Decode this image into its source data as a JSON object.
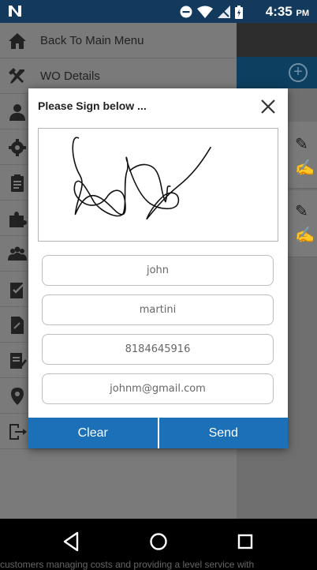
{
  "status_bar": {
    "time": "4:35",
    "ampm": "PM"
  },
  "drawer": {
    "items": [
      {
        "label": "Back To Main Menu",
        "icon": "home-icon"
      },
      {
        "label": "WO Details",
        "icon": "tools-icon"
      },
      {
        "label": "",
        "icon": "person-icon"
      },
      {
        "label": "",
        "icon": "gear-icon"
      },
      {
        "label": "",
        "icon": "clipboard-icon"
      },
      {
        "label": "",
        "icon": "puzzle-icon"
      },
      {
        "label": "",
        "icon": "group-icon"
      },
      {
        "label": "",
        "icon": "checklist-icon"
      },
      {
        "label": "",
        "icon": "document-icon"
      },
      {
        "label": "",
        "icon": "notes-icon"
      },
      {
        "label": "",
        "icon": "location-icon"
      },
      {
        "label": "",
        "icon": "logout-icon"
      }
    ]
  },
  "dialog": {
    "title": "Please Sign below ...",
    "fields": {
      "first_name": "john",
      "last_name": "martini",
      "phone": "8184645916",
      "email": "johnm@gmail.com"
    },
    "clear_label": "Clear",
    "send_label": "Send"
  },
  "footer_text": "customers managing costs and providing a level service with"
}
